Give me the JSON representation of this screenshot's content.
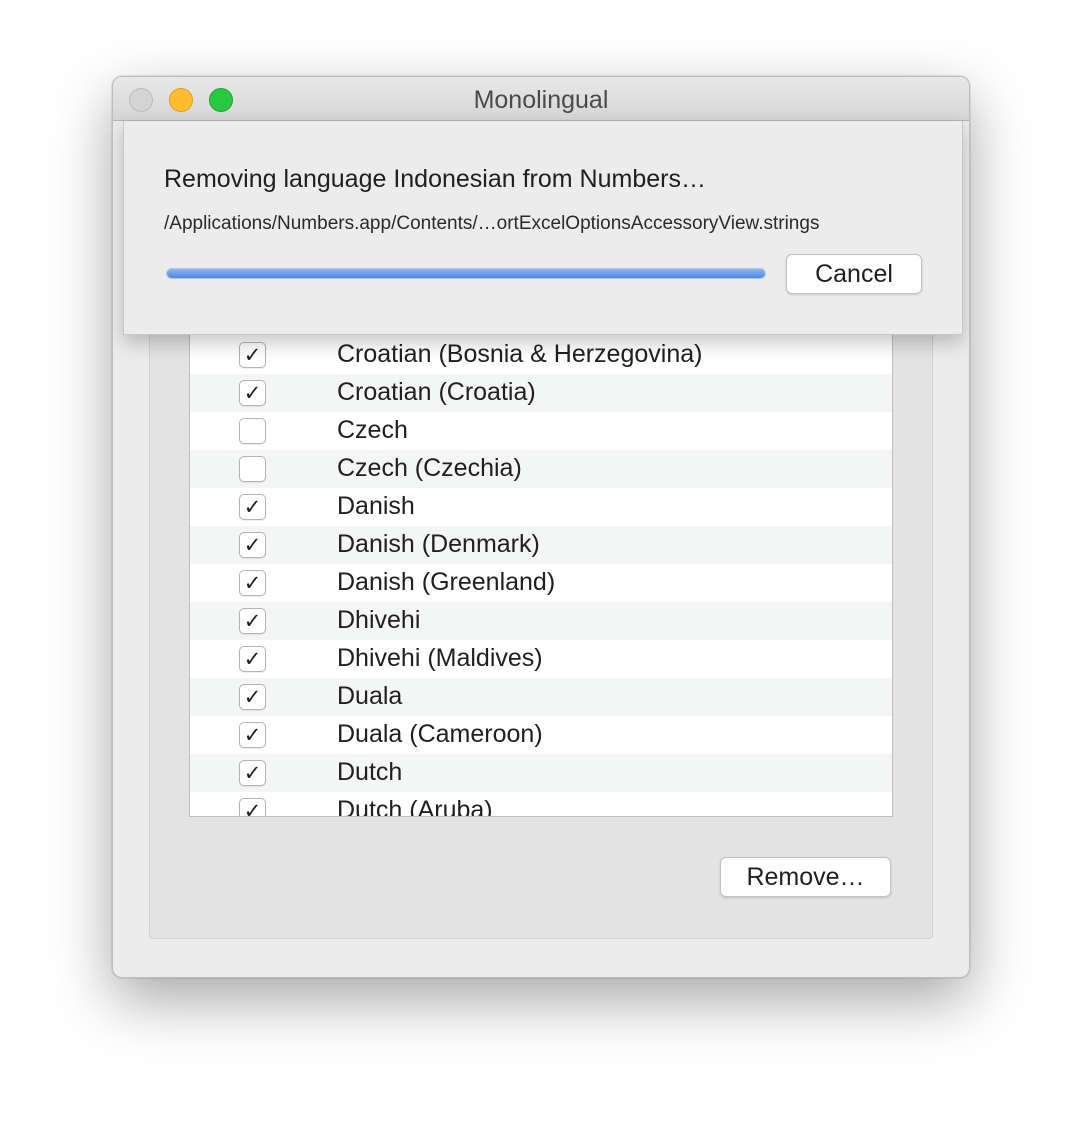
{
  "window": {
    "title": "Monolingual"
  },
  "sheet": {
    "message": "Removing language Indonesian from Numbers…",
    "path": "/Applications/Numbers.app/Contents/…ortExcelOptionsAccessoryView.strings",
    "progress": 1.0,
    "cancel_label": "Cancel"
  },
  "languages": [
    {
      "label": "Croatian (Bosnia & Herzegovina)",
      "checked": true
    },
    {
      "label": "Croatian (Croatia)",
      "checked": true
    },
    {
      "label": "Czech",
      "checked": false
    },
    {
      "label": "Czech (Czechia)",
      "checked": false
    },
    {
      "label": "Danish",
      "checked": true
    },
    {
      "label": "Danish (Denmark)",
      "checked": true
    },
    {
      "label": "Danish (Greenland)",
      "checked": true
    },
    {
      "label": "Dhivehi",
      "checked": true
    },
    {
      "label": "Dhivehi (Maldives)",
      "checked": true
    },
    {
      "label": "Duala",
      "checked": true
    },
    {
      "label": "Duala (Cameroon)",
      "checked": true
    },
    {
      "label": "Dutch",
      "checked": true
    },
    {
      "label": "Dutch (Aruba)",
      "checked": true
    }
  ],
  "remove_label": "Remove…",
  "colors": {
    "close": "#d4d4d4",
    "minimize": "#febc2e",
    "zoom": "#28c840",
    "progress": "#4b89e6"
  }
}
